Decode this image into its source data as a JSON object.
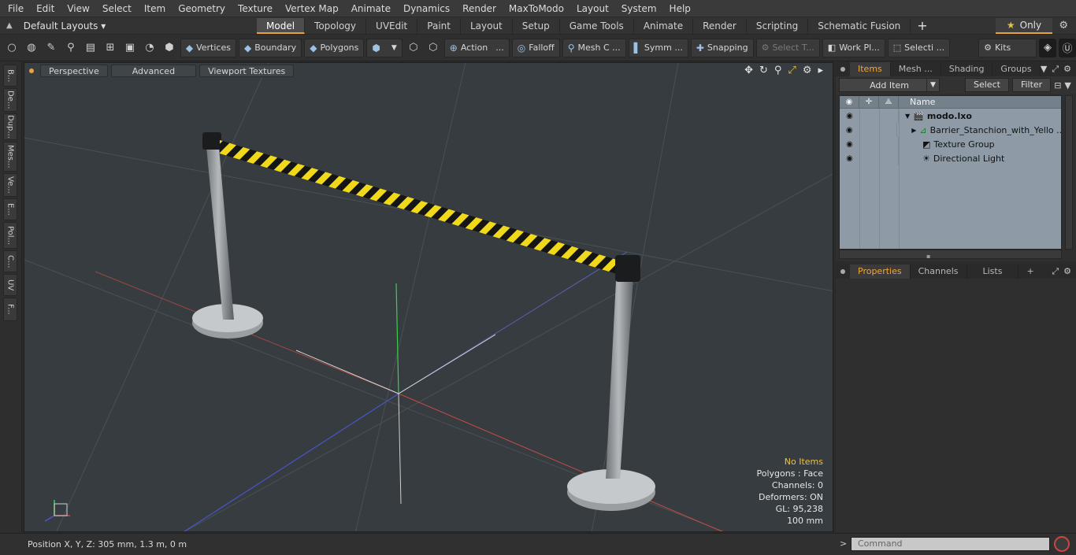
{
  "menu": [
    "File",
    "Edit",
    "View",
    "Select",
    "Item",
    "Geometry",
    "Texture",
    "Vertex Map",
    "Animate",
    "Dynamics",
    "Render",
    "MaxToModo",
    "Layout",
    "System",
    "Help"
  ],
  "layout": {
    "label": "Default Layouts ▾"
  },
  "tabs": [
    "Model",
    "Topology",
    "UVEdit",
    "Paint",
    "Layout",
    "Setup",
    "Game Tools",
    "Animate",
    "Render",
    "Scripting",
    "Schematic Fusion"
  ],
  "active_tab": "Model",
  "only_label": "Only",
  "toolbar": {
    "vertices": "Vertices",
    "boundary": "Boundary",
    "polygons": "Polygons",
    "action": "Action",
    "falloff": "Falloff",
    "mesh": "Mesh C ...",
    "symm": "Symm ...",
    "snapping": "Snapping",
    "select_t": "Select T...",
    "work_pl": "Work Pl...",
    "selecti": "Selecti ...",
    "kits": "Kits"
  },
  "left_tools": [
    "B...",
    "De...",
    "Dup...",
    "Mes...",
    "Ve...",
    "E...",
    "Pol...",
    "C...",
    "UV",
    "F..."
  ],
  "viewport": {
    "view": "Perspective",
    "shading": "Advanced",
    "textures": "Viewport Textures",
    "stats": {
      "no_items": "No Items",
      "polygons": "Polygons : Face",
      "channels": "Channels: 0",
      "deformers": "Deformers: ON",
      "gl": "GL: 95,238",
      "scale": "100 mm"
    }
  },
  "items_panel": {
    "tabs": [
      "Items",
      "Mesh ...",
      "Shading",
      "Groups"
    ],
    "add_item": "Add Item",
    "select": "Select",
    "filter": "Filter",
    "column_name": "Name",
    "tree": [
      {
        "label": "modo.lxo",
        "bold": true,
        "icon": "scene-icon"
      },
      {
        "label": "Barrier_Stanchion_with_Yello ...",
        "icon": "mesh-locator-icon"
      },
      {
        "label": "Texture Group",
        "icon": "texture-group-icon"
      },
      {
        "label": "Directional Light",
        "icon": "light-icon"
      }
    ]
  },
  "props_panel": {
    "tabs": [
      "Properties",
      "Channels",
      "Lists"
    ]
  },
  "status": {
    "position": "Position X, Y, Z:   305 mm, 1.3 m, 0 m",
    "command_placeholder": "Command"
  }
}
